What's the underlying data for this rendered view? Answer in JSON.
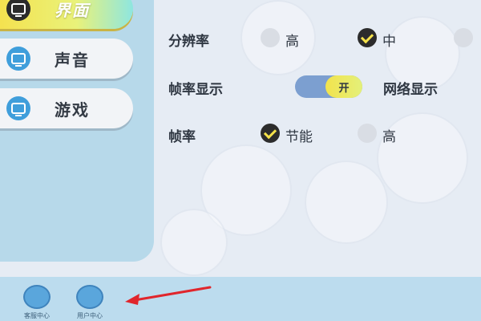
{
  "sidebar": {
    "tabs": [
      {
        "label": "界面",
        "active": true
      },
      {
        "label": "声音",
        "active": false
      },
      {
        "label": "游戏",
        "active": false
      }
    ]
  },
  "settings": {
    "resolution": {
      "label": "分辨率",
      "options": [
        {
          "label": "高",
          "checked": false
        },
        {
          "label": "中",
          "checked": true
        }
      ]
    },
    "fps_display": {
      "label": "帧率显示",
      "toggle_text": "开",
      "state": "on"
    },
    "network_display": {
      "label": "网络显示"
    },
    "fps": {
      "label": "帧率",
      "options": [
        {
          "label": "节能",
          "checked": true
        },
        {
          "label": "高",
          "checked": false
        }
      ]
    }
  },
  "bottom_bar": {
    "items": [
      {
        "label": "客服中心",
        "icon": "customer-service-icon"
      },
      {
        "label": "用户中心",
        "icon": "user-center-icon"
      }
    ]
  },
  "colors": {
    "accent_yellow": "#f2e34c",
    "sidebar_blue": "#b7d9ea",
    "toggle_blue": "#7c9fd0",
    "annotation_red": "#e0262c"
  }
}
